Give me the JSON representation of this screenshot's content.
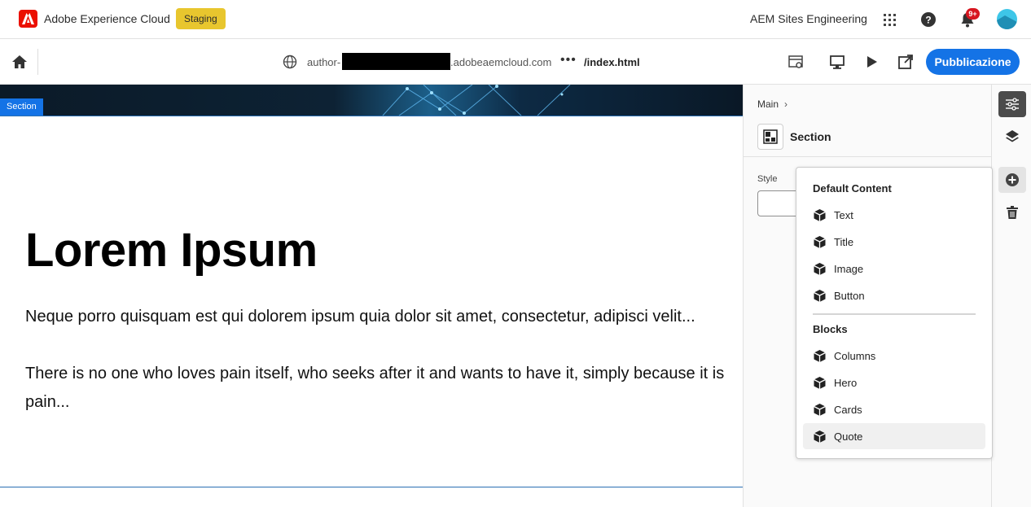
{
  "shell": {
    "app_title": "Adobe Experience Cloud",
    "environment": "Staging",
    "org_name": "AEM Sites Engineering",
    "notifications_badge": "9+",
    "icons": [
      "apps-grid-icon",
      "help-icon",
      "bell-icon",
      "avatar"
    ]
  },
  "toolbar": {
    "url_prefix": "author-",
    "url_domain": ".adobeaemcloud.com",
    "url_path": "/index.html",
    "more": "•••",
    "publish_label": "Pubblicazione",
    "publish_color": "#1473e6"
  },
  "canvas": {
    "section_tag": "Section",
    "heading": "Lorem Ipsum",
    "paragraph_1": "Neque porro quisquam est qui dolorem ipsum quia dolor sit amet, consectetur, adipisci velit...",
    "paragraph_2": "There is no one who loves pain itself, who seeks after it and wants to have it, simply because it is pain..."
  },
  "panel": {
    "breadcrumb": "Main",
    "component_name": "Section",
    "style_label": "Style"
  },
  "add_menu": {
    "default_heading": "Default Content",
    "default_items": [
      "Text",
      "Title",
      "Image",
      "Button"
    ],
    "blocks_heading": "Blocks",
    "block_items": [
      "Columns",
      "Hero",
      "Cards",
      "Quote"
    ],
    "highlighted_item": "Quote"
  }
}
